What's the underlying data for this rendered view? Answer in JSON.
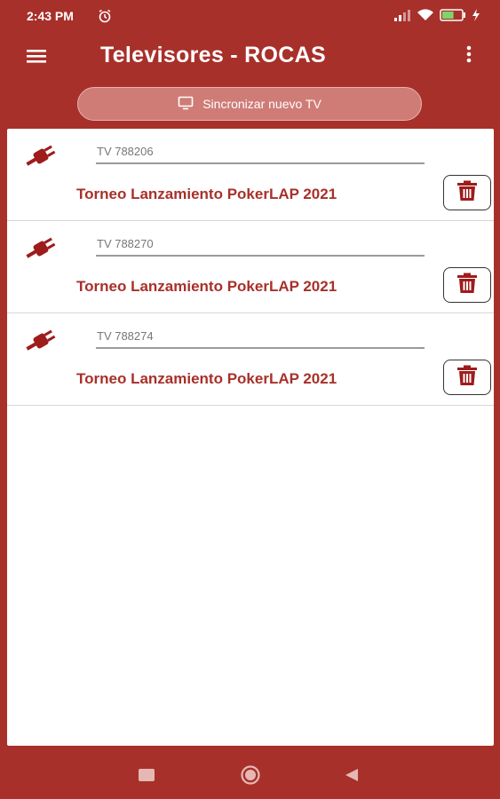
{
  "status_bar": {
    "time": "2:43 PM",
    "battery_level": 0.6
  },
  "app_bar": {
    "title": "Televisores - ROCAS",
    "menu_icon": "hamburger-menu-icon",
    "overflow_icon": "more-vertical-icon"
  },
  "sync": {
    "label": "Sincronizar nuevo TV",
    "icon": "monitor-icon"
  },
  "tvs": [
    {
      "id": "TV 788206",
      "tournament": "Torneo Lanzamiento PokerLAP 2021",
      "status_icon": "plug-icon",
      "action_icon": "trash-icon"
    },
    {
      "id": "TV 788270",
      "tournament": "Torneo Lanzamiento PokerLAP 2021",
      "status_icon": "plug-icon",
      "action_icon": "trash-icon"
    },
    {
      "id": "TV 788274",
      "tournament": "Torneo Lanzamiento PokerLAP 2021",
      "status_icon": "plug-icon",
      "action_icon": "trash-icon"
    }
  ],
  "colors": {
    "primary": "#a8302a",
    "accent": "#9e1c1c",
    "card": "#ffffff"
  }
}
